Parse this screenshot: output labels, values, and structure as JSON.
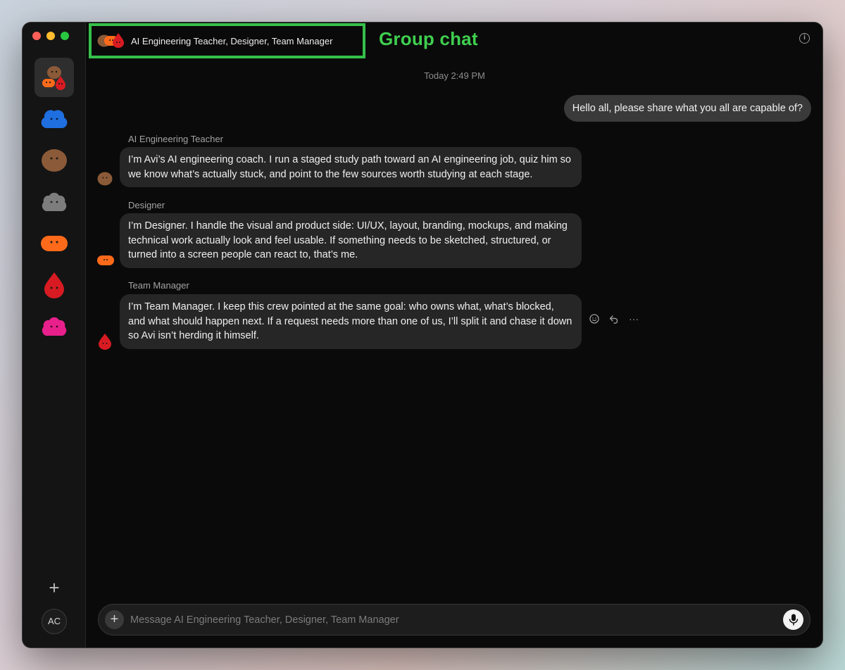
{
  "window": {
    "traffic_lights": [
      "close",
      "minimize",
      "zoom"
    ]
  },
  "sidebar": {
    "items": [
      {
        "name": "group-chat",
        "icon": "group-blob-icon",
        "active": true
      },
      {
        "name": "blue-agent",
        "icon": "blue-cloud-blob-icon",
        "color": "#1f6fe0"
      },
      {
        "name": "brown-agent",
        "icon": "brown-blob-icon",
        "color": "#8b5a38"
      },
      {
        "name": "gray-agent",
        "icon": "gray-cloud-blob-icon",
        "color": "#7d7d7d"
      },
      {
        "name": "orange-agent",
        "icon": "orange-pill-blob-icon",
        "color": "#ff6a1a"
      },
      {
        "name": "red-agent",
        "icon": "red-drop-blob-icon",
        "color": "#d81b22"
      },
      {
        "name": "pink-agent",
        "icon": "pink-cloud-blob-icon",
        "color": "#e8208c"
      }
    ],
    "add_label": "+",
    "user_initials": "AC"
  },
  "header": {
    "title": "AI Engineering Teacher, Designer, Team Manager",
    "annotation": "Group chat",
    "annotation_color": "#3fcf4f",
    "info_icon": "i"
  },
  "conversation": {
    "timestamp": "Today 2:49 PM",
    "user_message": "Hello all, please share what you all are capable of?",
    "messages": [
      {
        "sender": "AI Engineering Teacher",
        "text": "I’m Avi’s AI engineering coach. I run a staged study path toward an AI engineering job, quiz him so we know what’s actually stuck, and point to the few sources worth studying at each stage."
      },
      {
        "sender": "Designer",
        "text": "I’m Designer. I handle the visual and product side: UI/UX, layout, branding, mockups, and making technical work actually look and feel usable. If something needs to be sketched, structured, or turned into a screen people can react to, that’s me."
      },
      {
        "sender": "Team Manager",
        "text": "I’m Team Manager. I keep this crew pointed at the same goal: who owns what, what’s blocked, and what should happen next. If a request needs more than one of us, I’ll split it and chase it down so Avi isn’t herding it himself."
      }
    ],
    "actions": [
      "emoji-react-icon",
      "reply-icon",
      "more-icon"
    ],
    "more_label": "···"
  },
  "composer": {
    "placeholder": "Message AI Engineering Teacher, Designer, Team Manager",
    "add_label": "+"
  }
}
